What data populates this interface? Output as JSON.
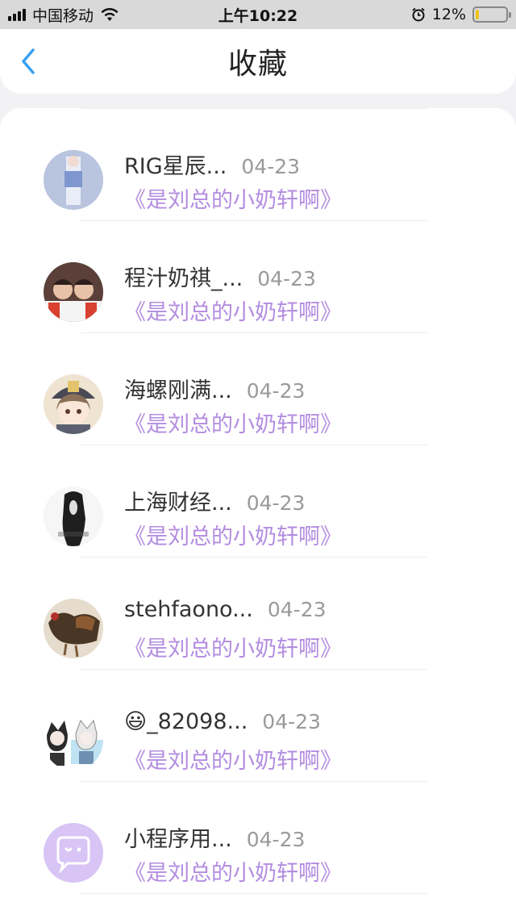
{
  "status_bar": {
    "carrier": "中国移动",
    "time": "上午10:22",
    "battery_text": "12%",
    "battery_level": 0.12
  },
  "header": {
    "title": "收藏"
  },
  "items": [
    {
      "name": "RIG星辰...",
      "date": "04-23",
      "subtitle": "《是刘总的小奶轩啊》"
    },
    {
      "name": "程汁奶祺_...",
      "date": "04-23",
      "subtitle": "《是刘总的小奶轩啊》"
    },
    {
      "name": "海螺刚满...",
      "date": "04-23",
      "subtitle": "《是刘总的小奶轩啊》"
    },
    {
      "name": "上海财经...",
      "date": "04-23",
      "subtitle": "《是刘总的小奶轩啊》"
    },
    {
      "name": "stehfaono...",
      "date": "04-23",
      "subtitle": "《是刘总的小奶轩啊》"
    },
    {
      "name": "😃_82098...",
      "date": "04-23",
      "subtitle": "《是刘总的小奶轩啊》"
    },
    {
      "name": "小程序用...",
      "date": "04-23",
      "subtitle": "《是刘总的小奶轩啊》"
    }
  ],
  "colors": {
    "accent": "#b38de0",
    "back_icon": "#3aa0f0",
    "miniprogram_avatar": "#d8c4f5"
  }
}
